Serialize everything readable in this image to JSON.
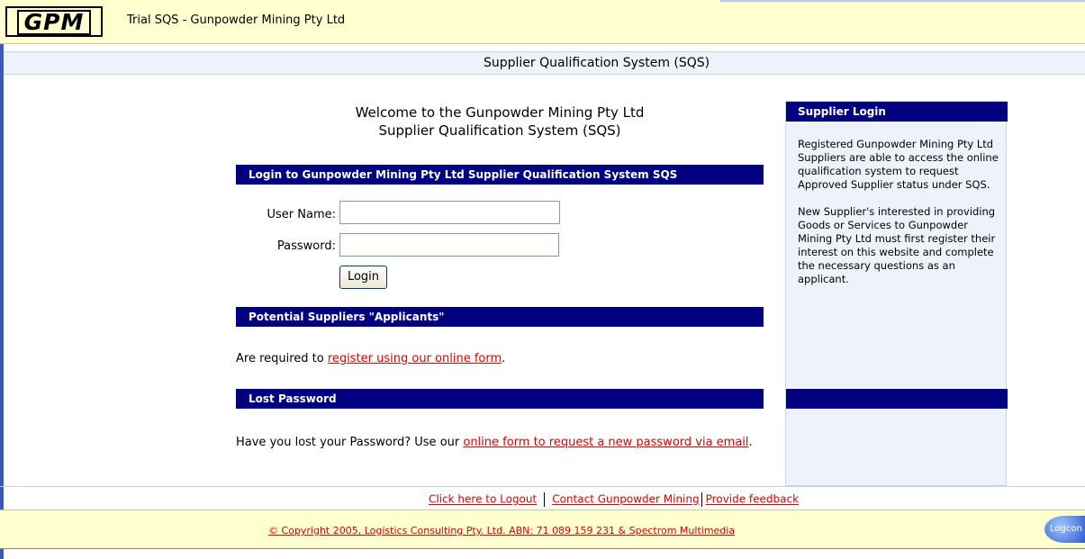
{
  "header": {
    "logo_text": "GPM",
    "title": "Trial SQS - Gunpowder Mining Pty Ltd"
  },
  "subheader": {
    "title": "Supplier Qualification System (SQS)"
  },
  "welcome": {
    "line1": "Welcome to the Gunpowder Mining Pty Ltd",
    "line2": "Supplier Qualification System (SQS)"
  },
  "login_section": {
    "heading": "Login to Gunpowder Mining Pty Ltd Supplier Qualification System SQS",
    "username_label": "User Name:",
    "username_value": "",
    "password_label": "Password:",
    "password_value": "",
    "login_button": "Login"
  },
  "applicants_section": {
    "heading": "Potential Suppliers \"Applicants\"",
    "text_before": "Are required to ",
    "link": "register using our online form",
    "text_after": "."
  },
  "lost_password_section": {
    "heading": "Lost Password",
    "text_before": "Have you lost your Password? Use our ",
    "link": "online form to request a new password via email",
    "text_after": "."
  },
  "sidebar": {
    "heading": "Supplier Login",
    "para1": "Registered Gunpowder Mining Pty Ltd Suppliers are able to access the online qualification system to request Approved Supplier status under SQS.",
    "para2": "New Supplier's interested in providing Goods or Services to Gunpowder Mining Pty Ltd must first register their interest on this website and complete the necessary questions as an applicant."
  },
  "footer": {
    "logout_link": "Click here to Logout",
    "contact_link": "Contact Gunpowder Mining",
    "feedback_link": "Provide feedback",
    "copyright": "© Copyright 2005, Logistics Consulting Pty. Ltd. ABN: 71 089 159 231 & Spectrom Multimedia",
    "badge": "Logcon"
  },
  "colors": {
    "header_bg": "#ffffd0",
    "bar_bg": "#000080",
    "panel_bg": "#eef3fb",
    "link": "#e00000"
  }
}
